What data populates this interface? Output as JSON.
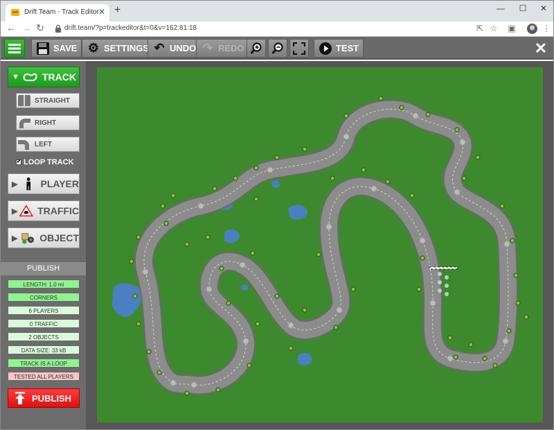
{
  "browser": {
    "tab_title": "Drift Team - Track Editor",
    "tab_close": "✕",
    "new_tab": "+",
    "url": "drift.team/?p=trackeditor&t=0&v=162:81:18",
    "minimize": "—",
    "maximize": "☐",
    "close": "✕"
  },
  "toolbar": {
    "save": "SAVE",
    "settings": "SETTINGS",
    "undo": "UNDO",
    "redo": "REDO",
    "test": "TEST"
  },
  "sidebar": {
    "track": "TRACK",
    "straight": "STRAIGHT",
    "right": "RIGHT",
    "left": "LEFT",
    "loop_track": "LOOP TRACK",
    "loop_checked": true,
    "player": "PLAYER",
    "traffic": "TRAFFIC",
    "object": "OBJECT"
  },
  "publish": {
    "header": "PUBLISH",
    "length": "LENGTH: 1.0 mi",
    "corners": "CORNERS",
    "players": "6 PLAYERS",
    "traffic": "0 TRAFFIC",
    "objects": "2 OBJECTS",
    "data_size": "DATA SIZE: 33 kB",
    "is_loop": "TRACK IS A LOOP",
    "tested": "TESTED ALL PLAYERS",
    "button": "PUBLISH"
  },
  "colors": {
    "grass": "#3d8a2e",
    "track": "#8a8a8a",
    "publish_red": "#ff2a2a",
    "accent_green": "#2aaa2a",
    "water": "#4a7fc1"
  }
}
